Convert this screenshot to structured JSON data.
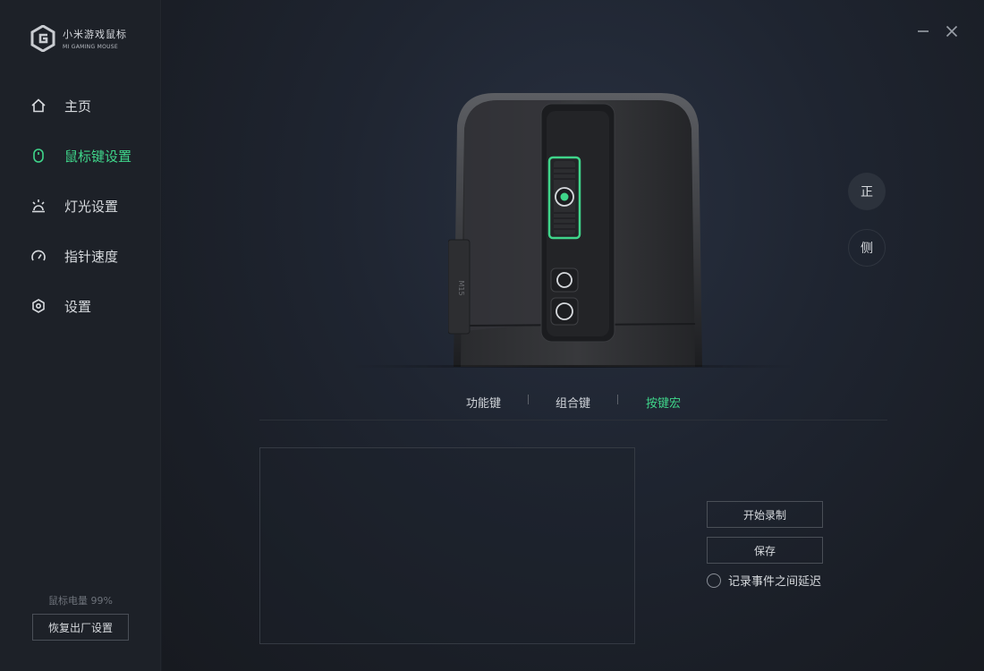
{
  "brand": {
    "name_cn": "小米游戏鼠标",
    "name_en": "MI GAMING MOUSE"
  },
  "window": {
    "minimize_icon": "minimize-icon",
    "close_icon": "close-icon"
  },
  "sidebar": {
    "items": [
      {
        "label": "主页",
        "icon": "home-icon",
        "active": false
      },
      {
        "label": "鼠标键设置",
        "icon": "mouse-icon",
        "active": true
      },
      {
        "label": "灯光设置",
        "icon": "light-icon",
        "active": false
      },
      {
        "label": "指针速度",
        "icon": "speedometer-icon",
        "active": false
      },
      {
        "label": "设置",
        "icon": "hex-gear-icon",
        "active": false
      }
    ],
    "battery_text": "鼠标电量 99%",
    "reset_label": "恢复出厂设置"
  },
  "mouse_view": {
    "model_label": "M15",
    "front_label": "正",
    "side_label": "侧",
    "accent_color": "#3fd58a"
  },
  "tabs": [
    {
      "label": "功能键",
      "active": false
    },
    {
      "label": "组合键",
      "active": false
    },
    {
      "label": "按键宏",
      "active": true
    }
  ],
  "macro": {
    "record_label": "开始录制",
    "save_label": "保存",
    "delay_label": "记录事件之间延迟",
    "delay_checked": false
  }
}
